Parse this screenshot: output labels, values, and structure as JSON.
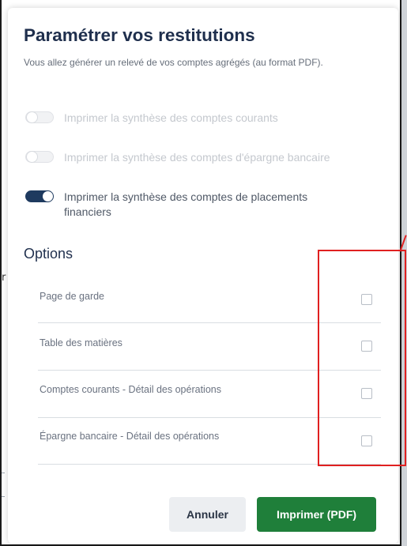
{
  "dialog": {
    "title": "Paramétrer vos restitutions",
    "subtitle": "Vous allez générer un relevé de vos comptes agrégés (au format PDF)."
  },
  "toggles": [
    {
      "label": "Imprimer la synthèse des comptes courants",
      "state": "off"
    },
    {
      "label": "Imprimer la synthèse des comptes d'épargne bancaire",
      "state": "off"
    },
    {
      "label": "Imprimer la synthèse des comptes de placements financiers",
      "state": "on"
    }
  ],
  "options": {
    "title": "Options",
    "items": [
      {
        "label": "Page de garde",
        "checked": false
      },
      {
        "label": "Table des matières",
        "checked": false
      },
      {
        "label": "Comptes courants - Détail des opérations",
        "checked": false
      },
      {
        "label": "Épargne bancaire - Détail des opérations",
        "checked": false
      }
    ]
  },
  "buttons": {
    "cancel_label": "Annuler",
    "print_label": "Imprimer (PDF)"
  },
  "background": {
    "edge_glyph": "r"
  },
  "colors": {
    "primary_button": "#1f7f3a",
    "toggle_on": "#1e3a5f",
    "highlight": "#e02020",
    "title": "#1f2f4d"
  }
}
